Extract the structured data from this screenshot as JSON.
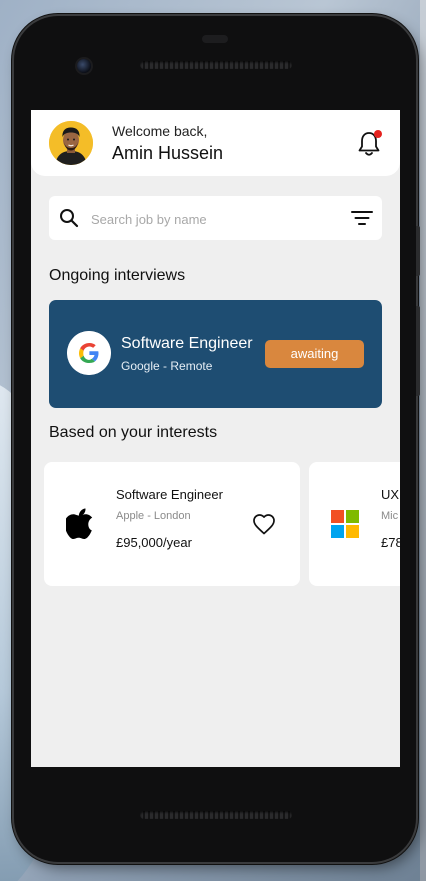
{
  "header": {
    "welcome_text": "Welcome back,",
    "user_name": "Amin Hussein",
    "avatar_bg": "#f4bd28",
    "notification_dot_color": "#e5221e",
    "icons": [
      "bell-icon",
      "avatar"
    ]
  },
  "search": {
    "placeholder": "Search job by name",
    "value": "",
    "icons": [
      "search-icon",
      "filter-icon"
    ]
  },
  "ongoing": {
    "section_title": "Ongoing interviews",
    "card": {
      "title": "Software Engineer",
      "subtitle": "Google - Remote",
      "status": "awaiting",
      "logo": "google-logo",
      "card_color": "#1e4d72",
      "status_color": "#d9873e"
    }
  },
  "interests": {
    "section_title": "Based on your interests",
    "jobs": [
      {
        "title": "Software Engineer",
        "subtitle": "Apple - London",
        "salary": "£95,000/year",
        "logo": "apple-logo",
        "favorite_icon": "heart-icon"
      },
      {
        "title": "UX",
        "subtitle": "Mic",
        "salary": "£78",
        "logo": "microsoft-logo"
      }
    ]
  }
}
